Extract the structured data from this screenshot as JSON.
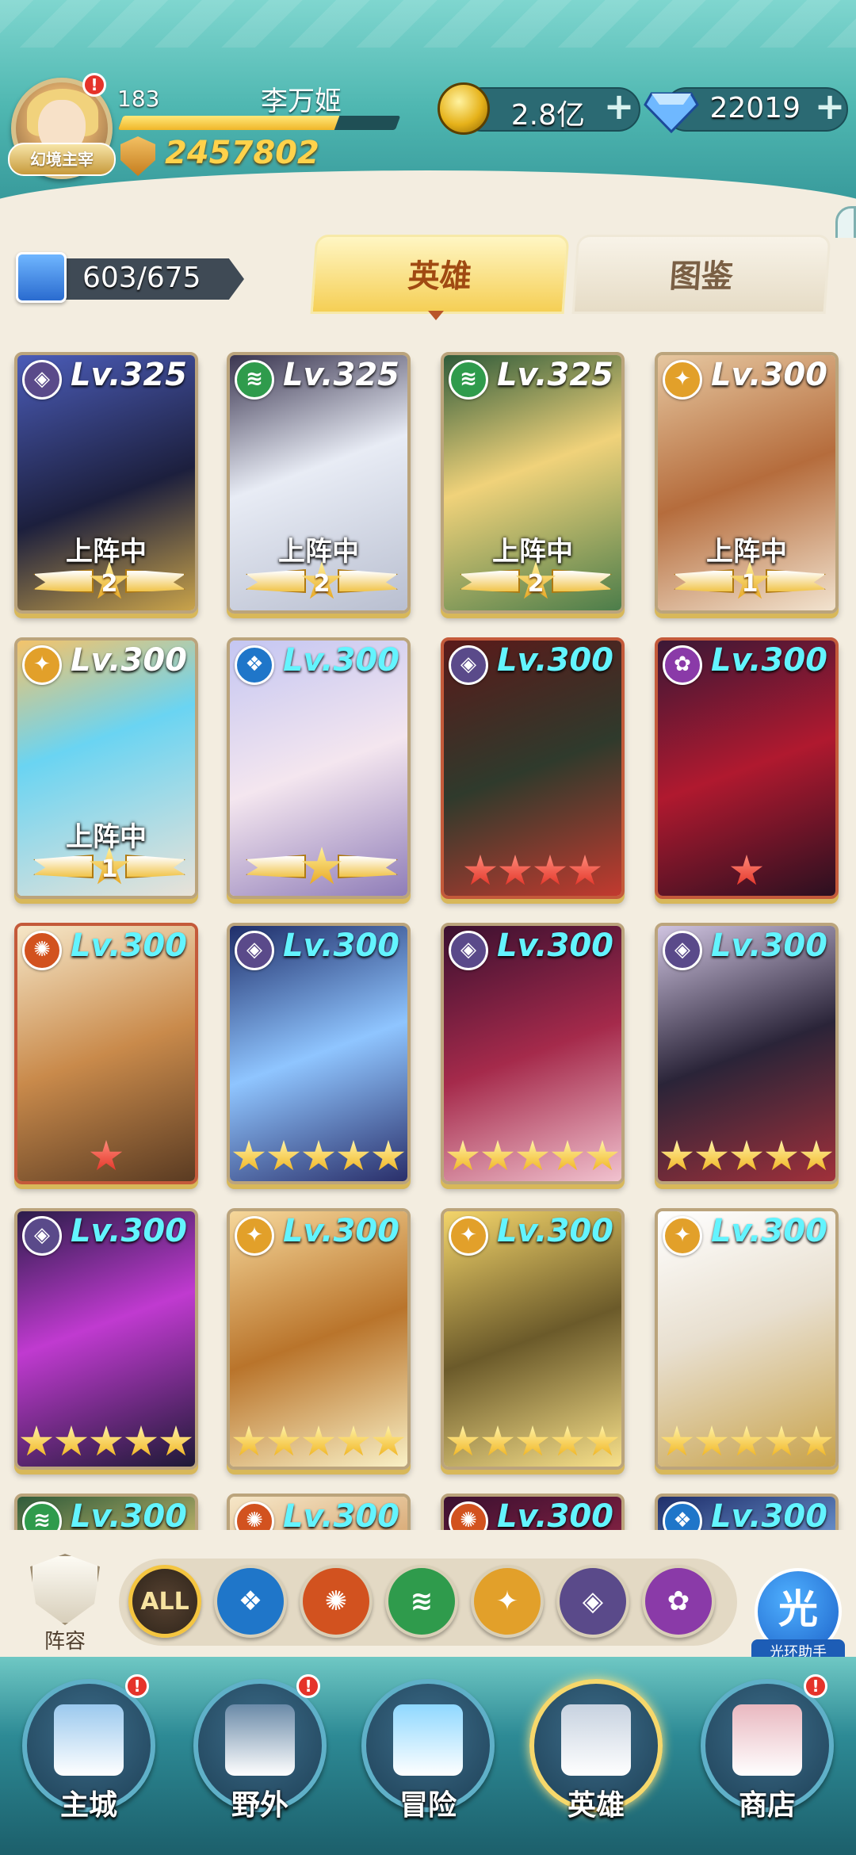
{
  "player": {
    "level": "183",
    "name": "李万姬",
    "badge": "幻境主宰",
    "power": "2457802",
    "xp_fraction": 0.78,
    "alert": "!"
  },
  "resources": {
    "gold": "2.8亿",
    "gems": "22019",
    "plus": "+"
  },
  "collection": {
    "count": "603/675"
  },
  "tabs": [
    {
      "label": "英雄",
      "active": true
    },
    {
      "label": "图鉴",
      "active": false
    }
  ],
  "deploy_label": "上阵中",
  "heroes": [
    {
      "element": "dark",
      "level": "Lv.325",
      "deployed": true,
      "rank": "2",
      "stars": 0,
      "star_color": "gold",
      "art": "anubis"
    },
    {
      "element": "wind",
      "level": "Lv.325",
      "deployed": true,
      "rank": "2",
      "stars": 0,
      "star_color": "gold",
      "art": "white"
    },
    {
      "element": "wind",
      "level": "Lv.325",
      "deployed": true,
      "rank": "2",
      "stars": 0,
      "star_color": "gold",
      "art": "green"
    },
    {
      "element": "light",
      "level": "Lv.300",
      "deployed": true,
      "rank": "1",
      "stars": 0,
      "star_color": "gold",
      "art": "monkey"
    },
    {
      "element": "light",
      "level": "Lv.300",
      "deployed": true,
      "rank": "1",
      "stars": 0,
      "star_color": "gold",
      "art": "blue"
    },
    {
      "element": "water",
      "level": "Lv.300",
      "deployed": false,
      "rank": "",
      "stars": 1,
      "star_color": "gold",
      "wing": true,
      "art": "lady"
    },
    {
      "element": "dark",
      "level": "Lv.300",
      "deployed": false,
      "rank": "",
      "stars": 4,
      "star_color": "red",
      "art": "skull"
    },
    {
      "element": "chaos",
      "level": "Lv.300",
      "deployed": false,
      "rank": "",
      "stars": 1,
      "star_color": "red",
      "art": "crimson"
    },
    {
      "element": "fire",
      "level": "Lv.300",
      "deployed": false,
      "rank": "",
      "stars": 1,
      "star_color": "red",
      "art": "goat"
    },
    {
      "element": "dark",
      "level": "Lv.300",
      "deployed": false,
      "rank": "",
      "stars": 5,
      "star_color": "gold",
      "art": "ghost"
    },
    {
      "element": "dark",
      "level": "Lv.300",
      "deployed": false,
      "rank": "",
      "stars": 5,
      "star_color": "gold",
      "art": "demon"
    },
    {
      "element": "dark",
      "level": "Lv.300",
      "deployed": false,
      "rank": "",
      "stars": 5,
      "star_color": "gold",
      "art": "ninja"
    },
    {
      "element": "dark",
      "level": "Lv.300",
      "deployed": false,
      "rank": "",
      "stars": 5,
      "star_color": "gold",
      "art": "purple"
    },
    {
      "element": "light",
      "level": "Lv.300",
      "deployed": false,
      "rank": "",
      "stars": 5,
      "star_color": "gold",
      "art": "twins"
    },
    {
      "element": "light",
      "level": "Lv.300",
      "deployed": false,
      "rank": "",
      "stars": 5,
      "star_color": "gold",
      "art": "yellow"
    },
    {
      "element": "light",
      "level": "Lv.300",
      "deployed": false,
      "rank": "",
      "stars": 5,
      "star_color": "gold",
      "art": "hood"
    },
    {
      "element": "wind",
      "level": "Lv.300",
      "deployed": false,
      "rank": "",
      "stars": 0,
      "star_color": "gold",
      "art": "green"
    },
    {
      "element": "fire",
      "level": "Lv.300",
      "deployed": false,
      "rank": "",
      "stars": 0,
      "star_color": "gold",
      "art": "goat"
    },
    {
      "element": "fire",
      "level": "Lv.300",
      "deployed": false,
      "rank": "",
      "stars": 0,
      "star_color": "gold",
      "art": "demon"
    },
    {
      "element": "water",
      "level": "Lv.300",
      "deployed": false,
      "rank": "",
      "stars": 0,
      "star_color": "gold",
      "art": "ghost"
    }
  ],
  "element_colors": {
    "dark": "#5a4a8a",
    "wind": "#2f9b4c",
    "light": "#e2a02a",
    "water": "#1f76c9",
    "fire": "#d2521f",
    "chaos": "#8a3aa8"
  },
  "element_glyphs": {
    "dark": "◈",
    "wind": "≋",
    "light": "✦",
    "water": "❖",
    "fire": "✺",
    "chaos": "✿"
  },
  "filters": [
    {
      "id": "all",
      "label": "ALL"
    },
    {
      "id": "water",
      "label": "❖"
    },
    {
      "id": "fire",
      "label": "✺"
    },
    {
      "id": "wind",
      "label": "≋"
    },
    {
      "id": "light",
      "label": "✦"
    },
    {
      "id": "dark",
      "label": "◈"
    },
    {
      "id": "chaos",
      "label": "✿"
    }
  ],
  "formation_label": "阵容",
  "helper": {
    "glyph": "光",
    "label": "光环助手"
  },
  "nav": [
    {
      "label": "主城",
      "alert": true,
      "icon": "castle-icon",
      "active": false
    },
    {
      "label": "野外",
      "alert": true,
      "icon": "portal-icon",
      "active": false
    },
    {
      "label": "冒险",
      "alert": false,
      "icon": "sword-icon",
      "active": false
    },
    {
      "label": "英雄",
      "alert": false,
      "icon": "knight-helmet-icon",
      "active": true
    },
    {
      "label": "商店",
      "alert": true,
      "icon": "shop-icon",
      "active": false
    }
  ]
}
